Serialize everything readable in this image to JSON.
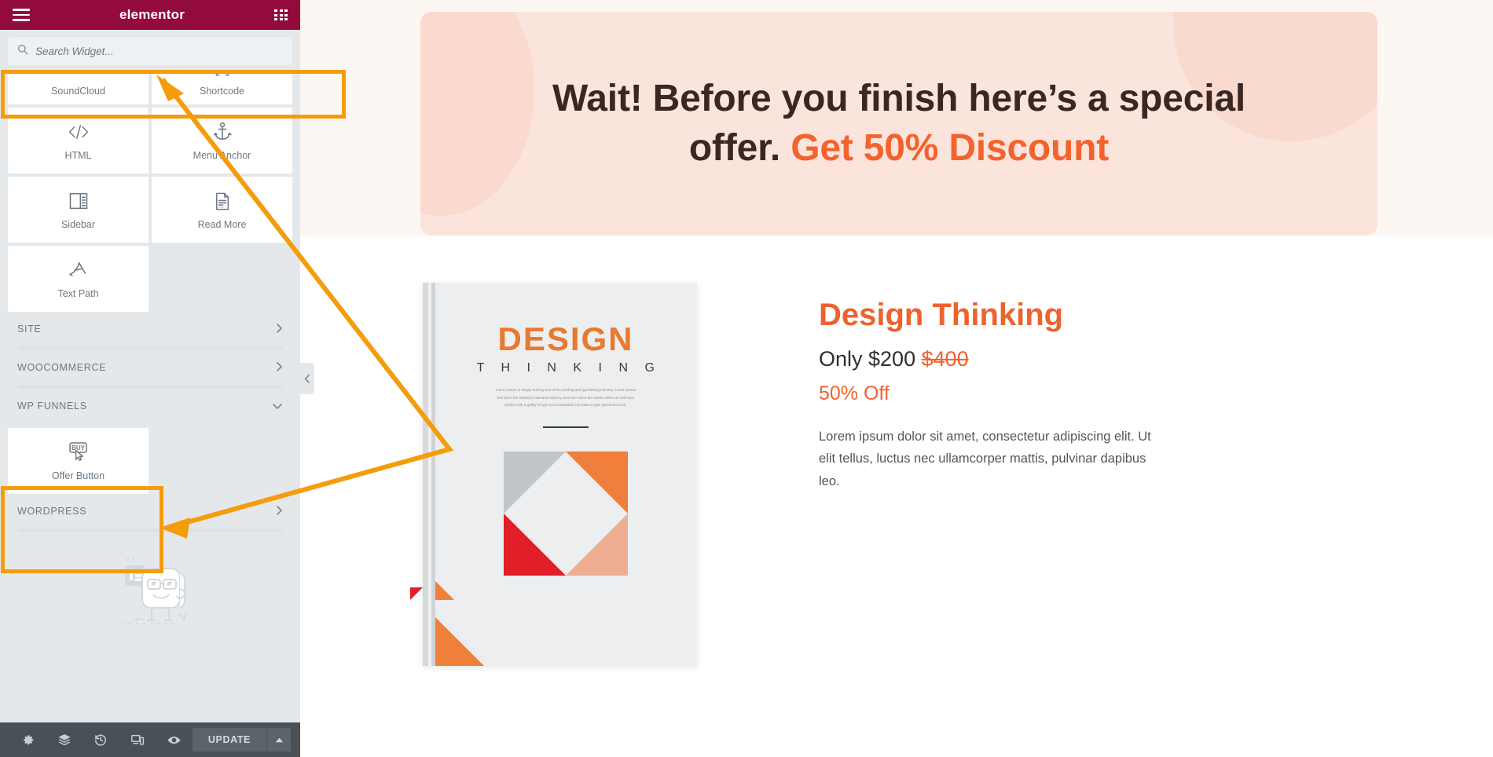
{
  "app": {
    "brand": "elementor",
    "menu_icon": "hamburger-icon",
    "apps_icon": "grid-apps-icon"
  },
  "search": {
    "placeholder": "Search Widget...",
    "value": "",
    "icon": "search-icon"
  },
  "widgets": [
    {
      "label": "SoundCloud",
      "icon": "soundcloud-icon",
      "clipped": true
    },
    {
      "label": "Shortcode",
      "icon": "shortcode-icon",
      "clipped": true
    },
    {
      "label": "HTML",
      "icon": "code-icon",
      "clipped": false
    },
    {
      "label": "Menu Anchor",
      "icon": "anchor-icon",
      "clipped": false
    },
    {
      "label": "Sidebar",
      "icon": "sidebar-layout-icon",
      "clipped": false
    },
    {
      "label": "Read More",
      "icon": "document-icon",
      "clipped": false
    },
    {
      "label": "Text Path",
      "icon": "text-path-icon",
      "clipped": false
    }
  ],
  "categories": [
    {
      "name": "SITE",
      "state": "collapsed",
      "chevron": "chevron-right-icon"
    },
    {
      "name": "WOOCOMMERCE",
      "state": "collapsed",
      "chevron": "chevron-right-icon"
    },
    {
      "name": "WP FUNNELS",
      "state": "expanded",
      "chevron": "chevron-down-icon"
    },
    {
      "name": "WORDPRESS",
      "state": "collapsed",
      "chevron": "chevron-right-icon"
    }
  ],
  "wp_funnels_widgets": [
    {
      "label": "Offer Button",
      "icon": "buy-button-cursor-icon"
    }
  ],
  "collapse_tab": {
    "icon": "chevron-left-icon"
  },
  "footer": {
    "icons": [
      {
        "name": "settings-gear-icon",
        "label": "Settings"
      },
      {
        "name": "layers-navigator-icon",
        "label": "Navigator"
      },
      {
        "name": "history-clock-icon",
        "label": "History"
      },
      {
        "name": "responsive-devices-icon",
        "label": "Responsive Mode"
      },
      {
        "name": "preview-eye-icon",
        "label": "Preview"
      }
    ],
    "update_label": "UPDATE",
    "update_caret": "caret-up-icon"
  },
  "banner": {
    "headline_plain": "Wait! Before you finish here’s a special offer. ",
    "headline_highlight": "Get 50% Discount",
    "bg_color": "#fae4dc",
    "highlight_color": "#f4622d"
  },
  "book_cover": {
    "title": "DESIGN",
    "subtitle": "T H I N K I N G",
    "body": "Lorem Ipsum is simply dummy text of the printing and typesetting industry. Lorem Ipsum has been the industry's standard dummy text ever since the 1500s, when an unknown printer took a galley of type and scrambled it to make a type specimen book.",
    "colors": {
      "title": "#e8792f",
      "pinwheel_top_left": "#c3c6c9",
      "pinwheel_top_right": "#ef7f3b",
      "pinwheel_bottom_left": "#e01f26",
      "pinwheel_bottom_right": "#eeae93"
    }
  },
  "product": {
    "title": "Design Thinking",
    "price_prefix": "Only $200 ",
    "price_old": "$400",
    "discount": "50% Off",
    "description": "Lorem ipsum dolor sit amet, consectetur adipiscing elit. Ut elit tellus, luctus nec ullamcorper mattis, pulvinar dapibus leo.",
    "title_color": "#ec6330",
    "accent_color": "#f4622d"
  },
  "annotations": {
    "color": "#f59c0b",
    "highlight_search_label": "search-widget-highlight",
    "highlight_offer_label": "offer-button-highlight",
    "arrow_label": "pointer-arrow"
  }
}
